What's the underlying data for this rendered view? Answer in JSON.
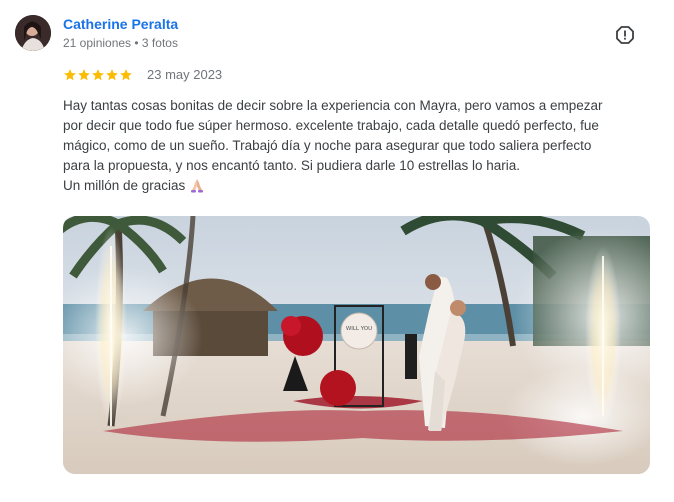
{
  "reviewer": {
    "name": "Catherine Peralta",
    "meta": "21 opiniones • 3 fotos"
  },
  "review": {
    "rating": 5,
    "max_rating": 5,
    "date": "23 may 2023",
    "text_lines": [
      "Hay tantas cosas bonitas de decir sobre la experiencia con Mayra, pero vamos a empezar",
      "por decir que todo fue súper hermoso. excelente trabajo, cada detalle quedó perfecto, fue",
      "mágico, como de un sueño. Trabajó día y noche para asegurar que todo saliera perfecto",
      "para la propuesta, y nos encantó tanto. Si pudiera darle 10 estrellas lo haria."
    ],
    "closing": "Un millón de gracias"
  },
  "photo": {
    "sign_line1": "WILL YOU"
  },
  "colors": {
    "name": "#1a73e8",
    "star": "#fbbc04",
    "meta": "#70757a"
  },
  "icons": {
    "menu": "report-flag-icon",
    "closing_emoji": "praying-hands-icon"
  }
}
